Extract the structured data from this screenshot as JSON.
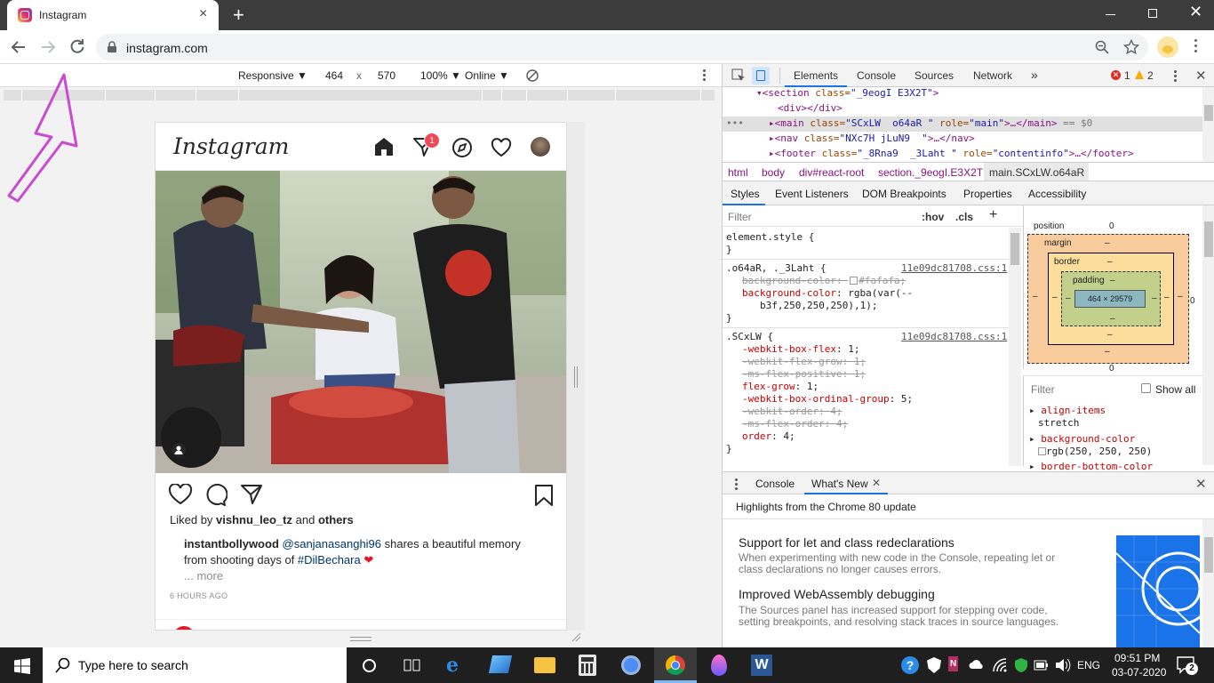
{
  "browser": {
    "tab_title": "Instagram",
    "url": "instagram.com",
    "new_tab_symbol": "+",
    "close_tab_symbol": "×"
  },
  "device_toolbar": {
    "mode": "Responsive ▼",
    "width": "464",
    "times": "x",
    "height": "570",
    "zoom": "100% ▼",
    "network": "Online ▼"
  },
  "instagram": {
    "logo": "Instagram",
    "notification_count": "1",
    "liked_by_prefix": "Liked by ",
    "liked_by_user": "vishnu_leo_tz",
    "liked_by_and": " and ",
    "liked_by_others": "others",
    "caption_user": "instantbollywood",
    "caption_mention": "@sanjanasanghi96",
    "caption_text1": " shares a beautiful memory",
    "caption_text2": "from shooting days of ",
    "caption_hashtag": "#DilBechara",
    "caption_heart": "❤",
    "more": "... more",
    "time": "6 HOURS AGO"
  },
  "devtools": {
    "tabs": [
      "Elements",
      "Console",
      "Sources",
      "Network",
      "»"
    ],
    "errors": "1",
    "warnings": "2",
    "dom": {
      "line1_tag_open": "▾<section",
      "line1_attr": " class=",
      "line1_val": "\"_9eogI E3X2T\"",
      "line1_close": ">",
      "line2": "<div></div>",
      "line3_tag": "▸<main",
      "line3_attr1": " class=",
      "line3_val1": "\"SCxLW  o64aR \"",
      "line3_attr2": " role=",
      "line3_val2": "\"main\"",
      "line3_rest": ">…</main>",
      "line3_eq": " == $0",
      "line4_tag": "▸<nav",
      "line4_attr": " class=",
      "line4_val": "\"NXc7H jLuN9  \"",
      "line4_rest": ">…</nav>",
      "line5_tag": "▸<footer",
      "line5_attr1": " class=",
      "line5_val1": "\"_8Rna9  _3Laht \"",
      "line5_attr2": " role=",
      "line5_val2": "\"contentinfo\"",
      "line5_rest": ">…</footer>"
    },
    "breadcrumbs": [
      "html",
      "body",
      "div#react-root",
      "section._9eogI.E3X2T",
      "main.SCxLW.o64aR"
    ],
    "subtabs": [
      "Styles",
      "Event Listeners",
      "DOM Breakpoints",
      "Properties",
      "Accessibility"
    ],
    "filter_placeholder": "Filter",
    "hov": ":hov",
    "cls": ".cls",
    "plus": "+",
    "styles": {
      "element_style": "element.style {",
      "close": "}",
      "rule1_selector": ".o64aR, ._3Laht {",
      "rule1_source": "11e09dc81708.css:1",
      "rule1_l1": "background-color: ",
      "rule1_l1v": "#fafafa;",
      "rule1_l2": "background-color",
      "rule1_l2v": ": rgba(var(--",
      "rule1_l3": "b3f,250,250,250),1);",
      "rule2_selector": ".SCxLW {",
      "rule2_source": "11e09dc81708.css:1",
      "rule2_lines": [
        {
          "p": "-webkit-box-flex",
          "v": ": 1;",
          "s": false
        },
        {
          "p": "-webkit-flex-grow",
          "v": ": 1;",
          "s": true
        },
        {
          "p": "-ms-flex-positive",
          "v": ": 1;",
          "s": true
        },
        {
          "p": "flex-grow",
          "v": ": 1;",
          "s": false
        },
        {
          "p": "-webkit-box-ordinal-group",
          "v": ": 5;",
          "s": false
        },
        {
          "p": "-webkit-order",
          "v": ": 4;",
          "s": true
        },
        {
          "p": "-ms-flex-order",
          "v": ": 4;",
          "s": true
        },
        {
          "p": "order",
          "v": ": 4;",
          "s": false
        }
      ]
    },
    "boxmodel": {
      "position": "position",
      "position_val": "0",
      "margin": "margin",
      "border": "border",
      "padding": "padding",
      "dash": "–",
      "content": "464 × 29579",
      "zero": "0"
    },
    "computed": {
      "filter": "Filter",
      "show_all": "Show all",
      "p1": "align-items",
      "v1": "stretch",
      "p2": "background-color",
      "v2": "rgb(250, 250, 250)",
      "p3": "border-bottom-color"
    },
    "drawer": {
      "tabs": [
        "Console",
        "What's New"
      ],
      "highlight": "Highlights from the Chrome 80 update",
      "h1": "Support for let and class redeclarations",
      "p1": "When experimenting with new code in the Console, repeating let or class declarations no longer causes errors.",
      "h2": "Improved WebAssembly debugging",
      "p2": "The Sources panel has increased support for stepping over code, setting breakpoints, and resolving stack traces in source languages."
    }
  },
  "taskbar": {
    "search": "Type here to search",
    "lang": "ENG",
    "time": "09:51 PM",
    "date": "03-07-2020",
    "notif": "2"
  }
}
